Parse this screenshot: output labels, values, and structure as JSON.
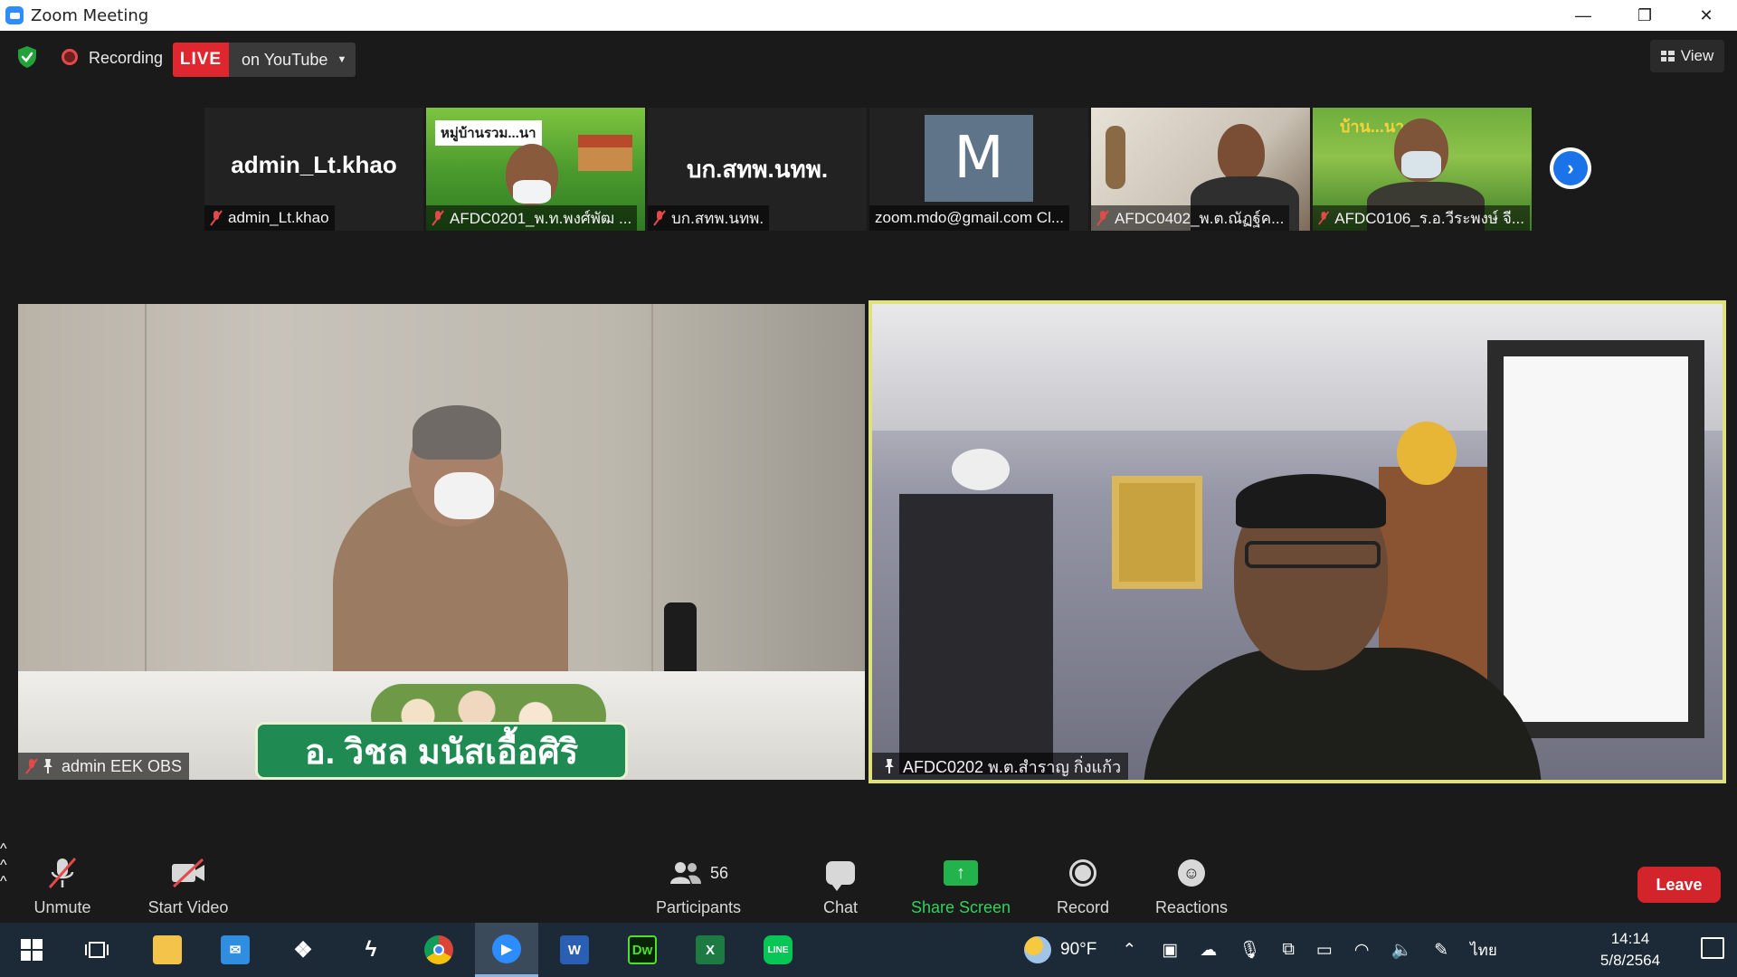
{
  "window": {
    "title": "Zoom Meeting",
    "controls": [
      "—",
      "❐",
      "✕"
    ]
  },
  "topbar": {
    "recording_label": "Recording",
    "live_badge": "LIVE",
    "live_target": "on YouTube",
    "view_label": "View"
  },
  "thumbnails": [
    {
      "big_name": "admin_Lt.khao",
      "caption": "admin_Lt.khao",
      "type": "name"
    },
    {
      "caption": "AFDC0201_พ.ท.พงศ์พัฒ ...",
      "overlay_text": "หมู่บ้านรวม...นา",
      "type": "video"
    },
    {
      "big_name": "บก.สทพ.นทพ.",
      "caption": "บก.สทพ.นทพ.",
      "type": "name"
    },
    {
      "avatar_letter": "M",
      "caption": "zoom.mdo@gmail.com Cl...",
      "type": "avatar"
    },
    {
      "caption": "AFDC0402_พ.ต.ณัฏฐ์ค...",
      "type": "video"
    },
    {
      "caption": "AFDC0106_ร.อ.วีระพงษ์ จี...",
      "overlay_text": "บ้าน...นา",
      "type": "video"
    }
  ],
  "main": {
    "left_caption": "admin EEK OBS",
    "left_nameplate": "อ. วิชล  มนัสเอื้อศิริ",
    "right_caption": "AFDC0202 พ.ต.สำราญ  กิ่งแก้ว"
  },
  "controls": {
    "unmute": "Unmute",
    "start_video": "Start Video",
    "participants": "Participants",
    "participants_count": "56",
    "chat": "Chat",
    "share_screen": "Share Screen",
    "record": "Record",
    "reactions": "Reactions",
    "leave": "Leave"
  },
  "taskbar": {
    "temperature": "90°F",
    "language": "ไทย",
    "time": "14:14",
    "date": "5/8/2564",
    "apps": [
      "start",
      "task-view",
      "file-explorer",
      "mail",
      "dropbox",
      "app-s",
      "chrome",
      "zoom",
      "word",
      "dreamweaver",
      "excel",
      "line"
    ],
    "active_app": "zoom"
  },
  "colors": {
    "live_red": "#e0262e",
    "share_green": "#22b34c",
    "leave_red": "#d4242b",
    "active_speaker_border": "#dfe27a",
    "accent_blue": "#1a73e8"
  }
}
